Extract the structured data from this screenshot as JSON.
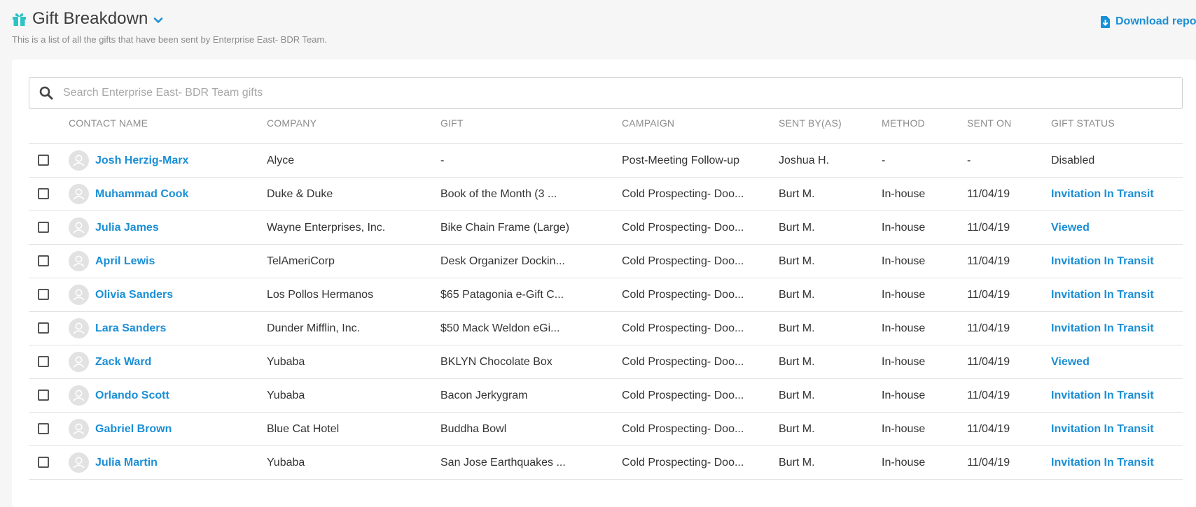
{
  "header": {
    "title": "Gift Breakdown",
    "subtitle": "This is a list of all the gifts that have been sent by Enterprise East- BDR Team.",
    "download_label": "Download repor"
  },
  "search": {
    "placeholder": "Search Enterprise East- BDR Team gifts",
    "value": ""
  },
  "table": {
    "columns": [
      "Contact Name",
      "Company",
      "Gift",
      "Campaign",
      "Sent By(As)",
      "Method",
      "Sent On",
      "Gift Status"
    ],
    "rows": [
      {
        "name": "Josh Herzig-Marx",
        "company": "Alyce",
        "gift": "-",
        "campaign": "Post-Meeting Follow-up",
        "sent_by": "Joshua H.",
        "method": "-",
        "sent_on": "-",
        "status": "Disabled"
      },
      {
        "name": "Muhammad Cook",
        "company": "Duke & Duke",
        "gift": "Book of the Month (3 ...",
        "campaign": "Cold Prospecting- Doo...",
        "sent_by": "Burt M.",
        "method": "In-house",
        "sent_on": "11/04/19",
        "status": "Invitation In Transit"
      },
      {
        "name": "Julia James",
        "company": "Wayne Enterprises, Inc.",
        "gift": "Bike Chain Frame (Large)",
        "campaign": "Cold Prospecting- Doo...",
        "sent_by": "Burt M.",
        "method": "In-house",
        "sent_on": "11/04/19",
        "status": "Viewed"
      },
      {
        "name": "April Lewis",
        "company": "TelAmeriCorp",
        "gift": "Desk Organizer Dockin...",
        "campaign": "Cold Prospecting- Doo...",
        "sent_by": "Burt M.",
        "method": "In-house",
        "sent_on": "11/04/19",
        "status": "Invitation In Transit"
      },
      {
        "name": "Olivia Sanders",
        "company": "Los Pollos Hermanos",
        "gift": "$65 Patagonia e-Gift C...",
        "campaign": "Cold Prospecting- Doo...",
        "sent_by": "Burt M.",
        "method": "In-house",
        "sent_on": "11/04/19",
        "status": "Invitation In Transit"
      },
      {
        "name": "Lara Sanders",
        "company": "Dunder Mifflin, Inc.",
        "gift": "$50 Mack Weldon eGi...",
        "campaign": "Cold Prospecting- Doo...",
        "sent_by": "Burt M.",
        "method": "In-house",
        "sent_on": "11/04/19",
        "status": "Invitation In Transit"
      },
      {
        "name": "Zack Ward",
        "company": "Yubaba",
        "gift": "BKLYN Chocolate Box",
        "campaign": "Cold Prospecting- Doo...",
        "sent_by": "Burt M.",
        "method": "In-house",
        "sent_on": "11/04/19",
        "status": "Viewed"
      },
      {
        "name": "Orlando Scott",
        "company": "Yubaba",
        "gift": "Bacon Jerkygram",
        "campaign": "Cold Prospecting- Doo...",
        "sent_by": "Burt M.",
        "method": "In-house",
        "sent_on": "11/04/19",
        "status": "Invitation In Transit"
      },
      {
        "name": "Gabriel Brown",
        "company": "Blue Cat Hotel",
        "gift": "Buddha Bowl",
        "campaign": "Cold Prospecting- Doo...",
        "sent_by": "Burt M.",
        "method": "In-house",
        "sent_on": "11/04/19",
        "status": "Invitation In Transit"
      },
      {
        "name": "Julia Martin",
        "company": "Yubaba",
        "gift": "San Jose Earthquakes ...",
        "campaign": "Cold Prospecting- Doo...",
        "sent_by": "Burt M.",
        "method": "In-house",
        "sent_on": "11/04/19",
        "status": "Invitation In Transit"
      }
    ]
  },
  "colors": {
    "accent": "#1b8fd6",
    "gift_icon": "#2cc3c6",
    "background": "#f6f6f6"
  },
  "icons": {
    "title": "gift-icon",
    "title_dropdown": "chevron-down-icon",
    "download": "file-download-icon",
    "search": "search-icon",
    "avatar": "user-avatar-icon"
  }
}
